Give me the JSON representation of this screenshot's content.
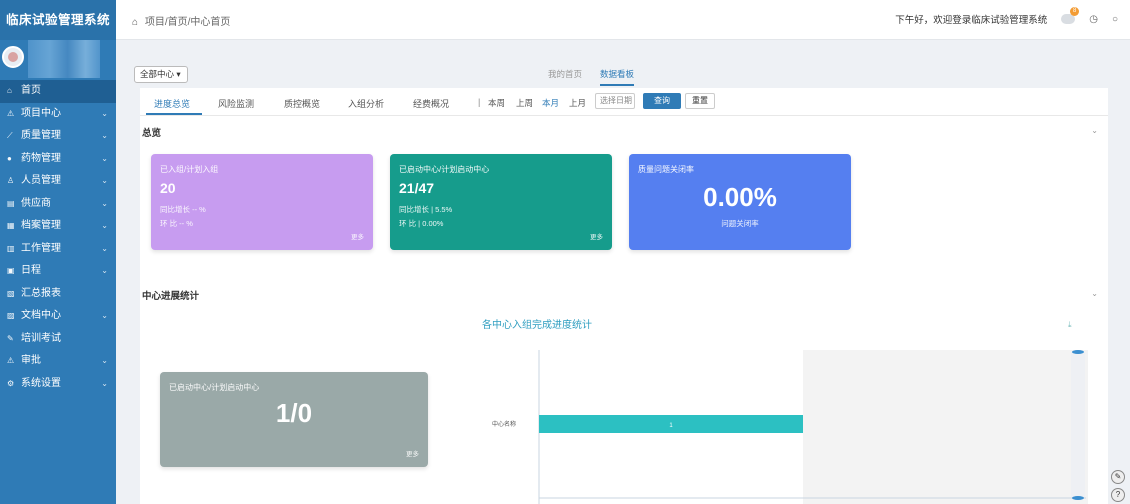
{
  "sidebar": {
    "brand": "临床试验管理系统",
    "items": [
      {
        "label": "首页",
        "icon": "home-icon",
        "glyph": "⌂",
        "chevron": false,
        "active": true
      },
      {
        "label": "项目中心",
        "icon": "warning-icon",
        "glyph": "⚠",
        "chevron": true
      },
      {
        "label": "质量管理",
        "icon": "chart-line-icon",
        "glyph": "⟋",
        "chevron": true
      },
      {
        "label": "药物管理",
        "icon": "drop-icon",
        "glyph": "●",
        "chevron": true
      },
      {
        "label": "人员管理",
        "icon": "person-icon",
        "glyph": "♙",
        "chevron": true
      },
      {
        "label": "供应商",
        "icon": "list-icon",
        "glyph": "▤",
        "chevron": true
      },
      {
        "label": "档案管理",
        "icon": "folder-icon",
        "glyph": "▦",
        "chevron": true
      },
      {
        "label": "工作管理",
        "icon": "task-icon",
        "glyph": "▥",
        "chevron": true
      },
      {
        "label": "日程",
        "icon": "calendar-icon",
        "glyph": "▣",
        "chevron": true
      },
      {
        "label": "汇总报表",
        "icon": "report-icon",
        "glyph": "▧",
        "chevron": false
      },
      {
        "label": "文档中心",
        "icon": "doc-icon",
        "glyph": "▨",
        "chevron": true
      },
      {
        "label": "培训考试",
        "icon": "exam-icon",
        "glyph": "✎",
        "chevron": false
      },
      {
        "label": "审批",
        "icon": "approval-icon",
        "glyph": "⚠",
        "chevron": true
      },
      {
        "label": "系统设置",
        "icon": "settings-icon",
        "glyph": "⚙",
        "chevron": true
      }
    ]
  },
  "topbar": {
    "breadcrumb": "项目/首页/中心首页",
    "notice": "下午好，欢迎登录临床试验管理系统",
    "badge_count": "8"
  },
  "content": {
    "select_label": "全部中心 ▾",
    "top_tabs": [
      "我的首页",
      "数据看板"
    ],
    "active_top_tab": 1,
    "sub_tabs": [
      "进度总览",
      "风险监测",
      "质控概览",
      "入组分析",
      "经费概况"
    ],
    "active_sub_tab": 0,
    "ranges": [
      "本周",
      "上周",
      "本月",
      "上月"
    ],
    "active_range": 2,
    "date_placeholder": "选择日期",
    "query_label": "查询",
    "reset_label": "重置"
  },
  "overview": {
    "title": "总览",
    "cards": [
      {
        "title": "已入组/计划入组",
        "value": "20",
        "line1": "同比增长 -- %",
        "line2": "环 比 -- %",
        "more": "更多",
        "color": "#c79cf0"
      },
      {
        "title": "已启动中心/计划启动中心",
        "value": "21/47",
        "line1": "同比增长 | 5.5%",
        "line2": "环 比 | 0.00%",
        "more": "更多",
        "color": "#169c8c"
      },
      {
        "title": "质量问题关闭率",
        "value": "0.00%",
        "caption": "问题关闭率",
        "color": "#557ff0"
      }
    ]
  },
  "center": {
    "title": "中心进展统计",
    "card": {
      "title": "已启动中心/计划启动中心",
      "value": "1/0",
      "more": "更多",
      "color": "#9aa9a8"
    },
    "chart_title": "各中心入组完成进度统计"
  },
  "chart_data": {
    "type": "bar",
    "orientation": "horizontal",
    "categories": [
      "中心名称"
    ],
    "values": [
      1
    ],
    "bar_color": "#2cc0c2"
  }
}
